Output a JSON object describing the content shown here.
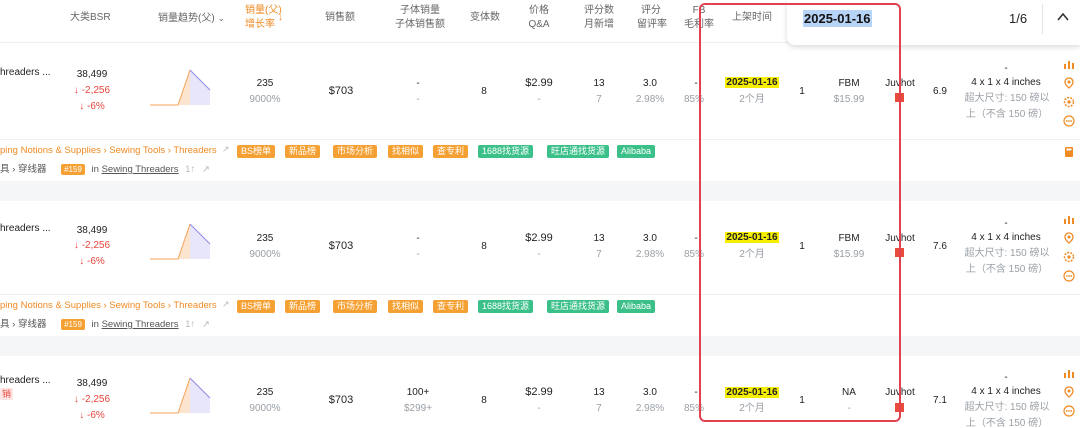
{
  "header": {
    "bsr": "大类BSR",
    "trend": "销量趋势(父)",
    "sales_l1": "销量(父)",
    "sales_l2": "增长率",
    "revenue": "销售额",
    "child_l1": "子体销量",
    "child_l2": "子体销售额",
    "variants": "变体数",
    "price_l1": "价格",
    "price_l2": "Q&A",
    "reviews_l1": "评分数",
    "reviews_l2": "月新增",
    "rating_l1": "评分",
    "rating_l2": "留评率",
    "fba_l1": "FB",
    "fba_l2": "毛利率",
    "listed": "上架时间"
  },
  "find_bar": {
    "query": "2025-01-16",
    "count": "1/6"
  },
  "rows": [
    {
      "title": "hreaders ...",
      "badge": "",
      "bsr": "38,499",
      "bsr_change": "↓ -2,256",
      "bsr_pct": "↓ -6%",
      "sales": "235",
      "growth": "9000%",
      "revenue": "$703",
      "child_sales": "-",
      "child_revenue": "-",
      "variants": "8",
      "price": "$2.99",
      "qa": "-",
      "ratings": "13",
      "ratings_new": "7",
      "score": "3.0",
      "review_rate": "2.98%",
      "fba": "-",
      "margin": "85%",
      "date": "2025-01-16",
      "age": "2个月",
      "sellers": "1",
      "fulfillment": "FBM",
      "fulfill_price": "$15.99",
      "brand": "Juvhot",
      "score2": "6.9",
      "dim_dash": "-",
      "dim1": "4 x 1 x 4 inches",
      "dim2": "超大尺寸: 150 磅以",
      "dim3": "上（不含 150 磅）",
      "crumbs": "ping Notions & Supplies › Sewing Tools › Threaders",
      "sub_cat": "具 › 穿线器",
      "rank": "#159",
      "in_text": "in",
      "in_cat": "Sewing Threaders",
      "in_tail": "1↑"
    },
    {
      "title": "hreaders ...",
      "badge": "",
      "bsr": "38,499",
      "bsr_change": "↓ -2,256",
      "bsr_pct": "↓ -6%",
      "sales": "235",
      "growth": "9000%",
      "revenue": "$703",
      "child_sales": "-",
      "child_revenue": "-",
      "variants": "8",
      "price": "$2.99",
      "qa": "-",
      "ratings": "13",
      "ratings_new": "7",
      "score": "3.0",
      "review_rate": "2.98%",
      "fba": "-",
      "margin": "85%",
      "date": "2025-01-16",
      "age": "2个月",
      "sellers": "1",
      "fulfillment": "FBM",
      "fulfill_price": "$15.99",
      "brand": "Juvhot",
      "score2": "7.6",
      "dim_dash": "-",
      "dim1": "4 x 1 x 4 inches",
      "dim2": "超大尺寸: 150 磅以",
      "dim3": "上（不含 150 磅）",
      "crumbs": "ping Notions & Supplies › Sewing Tools › Threaders",
      "sub_cat": "具 › 穿线器",
      "rank": "#159",
      "in_text": "in",
      "in_cat": "Sewing Threaders",
      "in_tail": "1↑"
    },
    {
      "title": "hreaders ...",
      "badge": "销",
      "bsr": "38,499",
      "bsr_change": "↓ -2,256",
      "bsr_pct": "↓ -6%",
      "sales": "235",
      "growth": "9000%",
      "revenue": "$703",
      "child_sales": "100+",
      "child_revenue": "$299+",
      "variants": "8",
      "price": "$2.99",
      "qa": "-",
      "ratings": "13",
      "ratings_new": "7",
      "score": "3.0",
      "review_rate": "2.98%",
      "fba": "-",
      "margin": "85%",
      "date": "2025-01-16",
      "age": "2个月",
      "sellers": "1",
      "fulfillment": "NA",
      "fulfill_price": "-",
      "brand": "Juvhot",
      "score2": "7.1",
      "dim_dash": "-",
      "dim1": "4 x 1 x 4 inches",
      "dim2": "超大尺寸: 150 磅以",
      "dim3": "上（不含 150 磅）"
    }
  ],
  "tags": [
    {
      "label": "BS榜单",
      "kind": "o"
    },
    {
      "label": "新品榜",
      "kind": "o"
    },
    {
      "label": "市场分析",
      "kind": "o"
    },
    {
      "label": "找相似",
      "kind": "o"
    },
    {
      "label": "查专利",
      "kind": "o"
    },
    {
      "label": "1688找货源",
      "kind": "g"
    },
    {
      "label": "旺店通找货源",
      "kind": "g"
    },
    {
      "label": "Alibaba",
      "kind": "g"
    }
  ],
  "colors": {
    "accent": "#f08a24",
    "highlight": "#f5ee00",
    "negative": "#e8453c",
    "tag_green": "#3cc08a",
    "tag_orange": "#f5a033",
    "annotation_box": "#e0424f"
  }
}
